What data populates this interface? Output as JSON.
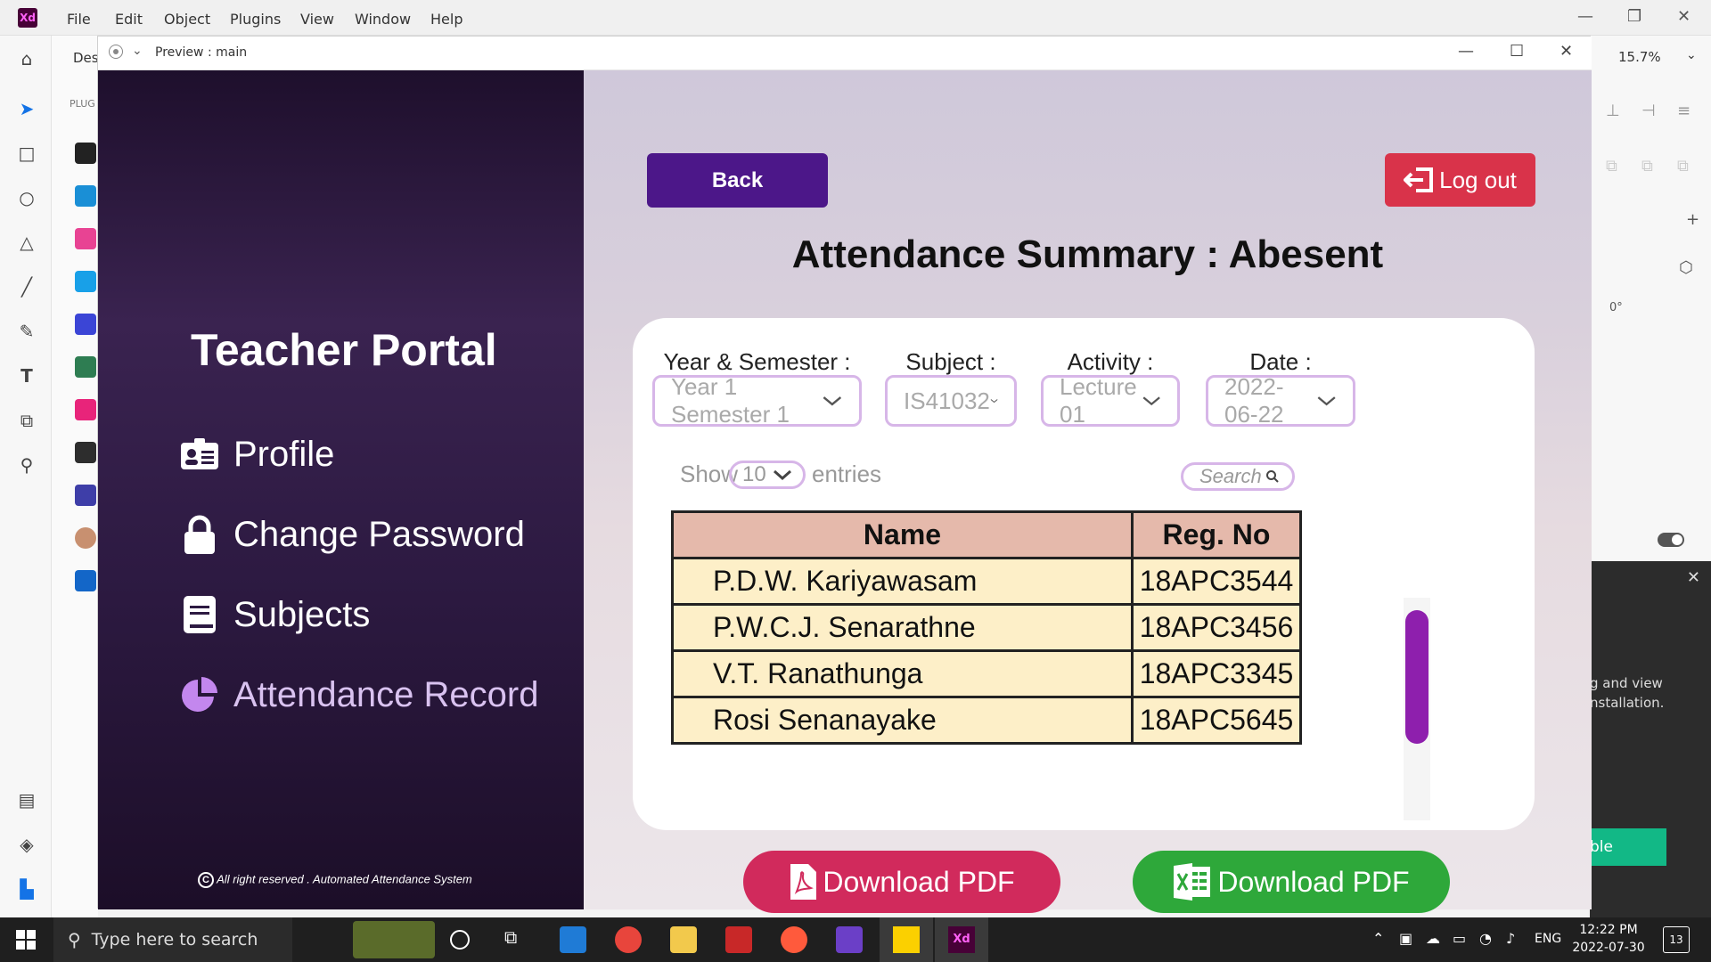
{
  "xd": {
    "logo": "Xd",
    "menu": [
      "File",
      "Edit",
      "Object",
      "Plugins",
      "View",
      "Window",
      "Help"
    ],
    "tab_partial": "Des",
    "plugins_label": "PLUG",
    "zoom": "15.7%",
    "rotation": "0°",
    "toast_text_line1": "g and view",
    "toast_text_line2": "nstallation.",
    "toast_button": "ble"
  },
  "preview": {
    "title": "Preview : main"
  },
  "sidebar": {
    "title": "Teacher Portal",
    "items": [
      {
        "label": "Profile",
        "icon": "id-card-icon"
      },
      {
        "label": "Change Password",
        "icon": "lock-icon"
      },
      {
        "label": "Subjects",
        "icon": "book-icon"
      },
      {
        "label": "Attendance Record",
        "icon": "pie-chart-icon"
      }
    ],
    "copyright": "All right reserved . Automated Attendance System"
  },
  "main": {
    "back_label": "Back",
    "logout_label": "Log out",
    "title": "Attendance Summary : Abesent",
    "filters": {
      "year_label": "Year & Semester :",
      "year_value": "Year 1 Semester 1",
      "subject_label": "Subject :",
      "subject_value": "IS41032",
      "activity_label": "Activity :",
      "activity_value": "Lecture 01",
      "date_label": "Date :",
      "date_value": "2022-06-22"
    },
    "show_label": "Show",
    "show_value": "10",
    "entries_label": "entries",
    "search_placeholder": "Search",
    "table": {
      "headers": [
        "Name",
        "Reg. No"
      ],
      "rows": [
        [
          "P.D.W. Kariyawasam",
          "18APC3544"
        ],
        [
          "P.W.C.J. Senarathne",
          "18APC3456"
        ],
        [
          "V.T. Ranathunga",
          "18APC3345"
        ],
        [
          "Rosi Senanayake",
          "18APC5645"
        ]
      ]
    },
    "download_pdf_label": "Download PDF",
    "download_excel_label": "Download PDF",
    "colors": {
      "back": "#4c1789",
      "logout": "#d9334a",
      "pdf": "#d12a5c",
      "excel": "#2ea83a",
      "scrollbar": "#8e1fad"
    }
  },
  "taskbar": {
    "search_placeholder": "Type here to search",
    "lang": "ENG",
    "time": "12:22 PM",
    "date": "2022-07-30",
    "notifications": "13"
  }
}
